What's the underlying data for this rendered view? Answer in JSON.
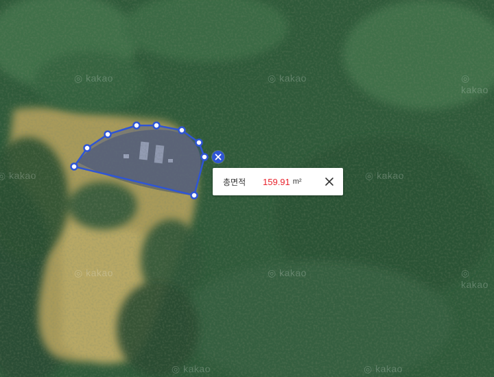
{
  "map": {
    "type": "satellite",
    "watermark_text": "kakao"
  },
  "measurement": {
    "tool": "area",
    "shape_color": "#2f55d4",
    "label": "총면적",
    "value": "159.91",
    "unit": "m²",
    "value_color": "#e8212b"
  },
  "icons": {
    "popup_close": "close-icon",
    "remove_shape": "close-icon"
  }
}
